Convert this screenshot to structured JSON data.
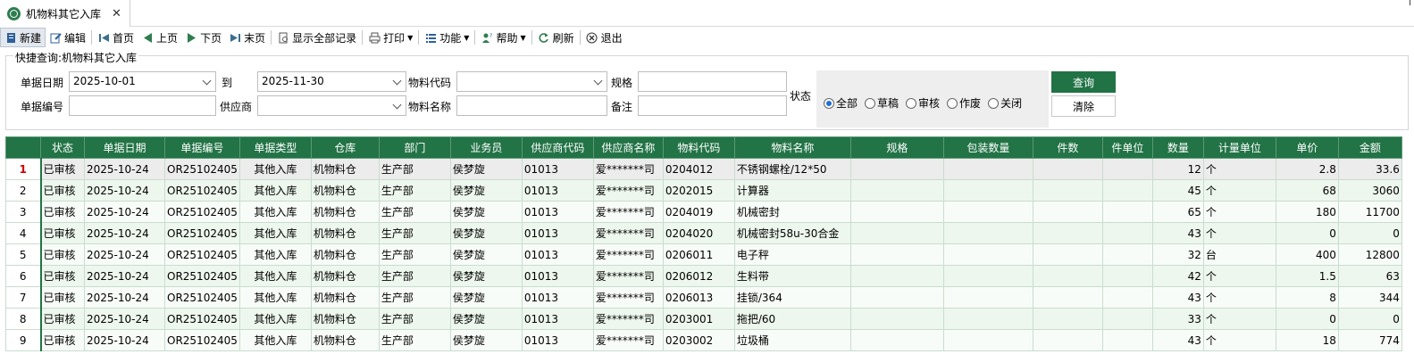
{
  "tab": {
    "title": "机物料其它入库",
    "close": "✕"
  },
  "toolbar": {
    "new": "新建",
    "edit": "编辑",
    "first": "首页",
    "prev": "上页",
    "next": "下页",
    "last": "末页",
    "show_all": "显示全部记录",
    "print": "打印",
    "func": "功能",
    "help": "帮助",
    "refresh": "刷新",
    "exit": "退出"
  },
  "quick": {
    "title": "快捷查询:机物料其它入库",
    "date_label": "单据日期",
    "date_from": "2025-10-01",
    "to_label": "到",
    "date_to": "2025-11-30",
    "material_code_label": "物料代码",
    "material_code": "",
    "spec_label": "规格",
    "spec": "",
    "status_label": "状态",
    "doc_no_label": "单据编号",
    "doc_no": "",
    "supplier_label": "供应商",
    "supplier": "",
    "material_name_label": "物料名称",
    "material_name": "",
    "remark_label": "备注",
    "remark": "",
    "status_options": [
      "全部",
      "草稿",
      "审核",
      "作废",
      "关闭"
    ],
    "status_selected": "全部",
    "query_button": "查询",
    "clear_button": "清除"
  },
  "grid": {
    "columns": [
      "状态",
      "单据日期",
      "单据编号",
      "单据类型",
      "仓库",
      "部门",
      "业务员",
      "供应商代码",
      "供应商名称",
      "物料代码",
      "物料名称",
      "规格",
      "包装数量",
      "件数",
      "件单位",
      "数量",
      "计量单位",
      "单价",
      "金额"
    ],
    "rows": [
      {
        "n": "1",
        "status": "已审核",
        "date": "2025-10-24",
        "no": "OR25102405",
        "type": "其他入库",
        "wh": "机物料仓",
        "dept": "生产部",
        "sales": "侯梦旋",
        "scode": "01013",
        "sname": "爱*******司",
        "mcode": "0204012",
        "mname": "不锈钢螺栓/12*50",
        "spec": "",
        "pack": "",
        "pcs": "",
        "pu": "",
        "qty": "12",
        "unit": "个",
        "price": "2.8",
        "amt": "33.6"
      },
      {
        "n": "2",
        "status": "已审核",
        "date": "2025-10-24",
        "no": "OR25102405",
        "type": "其他入库",
        "wh": "机物料仓",
        "dept": "生产部",
        "sales": "侯梦旋",
        "scode": "01013",
        "sname": "爱*******司",
        "mcode": "0202015",
        "mname": "计算器",
        "spec": "",
        "pack": "",
        "pcs": "",
        "pu": "",
        "qty": "45",
        "unit": "个",
        "price": "68",
        "amt": "3060"
      },
      {
        "n": "3",
        "status": "已审核",
        "date": "2025-10-24",
        "no": "OR25102405",
        "type": "其他入库",
        "wh": "机物料仓",
        "dept": "生产部",
        "sales": "侯梦旋",
        "scode": "01013",
        "sname": "爱*******司",
        "mcode": "0204019",
        "mname": "机械密封",
        "spec": "",
        "pack": "",
        "pcs": "",
        "pu": "",
        "qty": "65",
        "unit": "个",
        "price": "180",
        "amt": "11700"
      },
      {
        "n": "4",
        "status": "已审核",
        "date": "2025-10-24",
        "no": "OR25102405",
        "type": "其他入库",
        "wh": "机物料仓",
        "dept": "生产部",
        "sales": "侯梦旋",
        "scode": "01013",
        "sname": "爱*******司",
        "mcode": "0204020",
        "mname": "机械密封58u-30合金",
        "spec": "",
        "pack": "",
        "pcs": "",
        "pu": "",
        "qty": "43",
        "unit": "个",
        "price": "0",
        "amt": "0"
      },
      {
        "n": "5",
        "status": "已审核",
        "date": "2025-10-24",
        "no": "OR25102405",
        "type": "其他入库",
        "wh": "机物料仓",
        "dept": "生产部",
        "sales": "侯梦旋",
        "scode": "01013",
        "sname": "爱*******司",
        "mcode": "0206011",
        "mname": "电子秤",
        "spec": "",
        "pack": "",
        "pcs": "",
        "pu": "",
        "qty": "32",
        "unit": "台",
        "price": "400",
        "amt": "12800"
      },
      {
        "n": "6",
        "status": "已审核",
        "date": "2025-10-24",
        "no": "OR25102405",
        "type": "其他入库",
        "wh": "机物料仓",
        "dept": "生产部",
        "sales": "侯梦旋",
        "scode": "01013",
        "sname": "爱*******司",
        "mcode": "0206012",
        "mname": "生料带",
        "spec": "",
        "pack": "",
        "pcs": "",
        "pu": "",
        "qty": "42",
        "unit": "个",
        "price": "1.5",
        "amt": "63"
      },
      {
        "n": "7",
        "status": "已审核",
        "date": "2025-10-24",
        "no": "OR25102405",
        "type": "其他入库",
        "wh": "机物料仓",
        "dept": "生产部",
        "sales": "侯梦旋",
        "scode": "01013",
        "sname": "爱*******司",
        "mcode": "0206013",
        "mname": "挂锁/364",
        "spec": "",
        "pack": "",
        "pcs": "",
        "pu": "",
        "qty": "43",
        "unit": "个",
        "price": "8",
        "amt": "344"
      },
      {
        "n": "8",
        "status": "已审核",
        "date": "2025-10-24",
        "no": "OR25102405",
        "type": "其他入库",
        "wh": "机物料仓",
        "dept": "生产部",
        "sales": "侯梦旋",
        "scode": "01013",
        "sname": "爱*******司",
        "mcode": "0203001",
        "mname": "拖把/60",
        "spec": "",
        "pack": "",
        "pcs": "",
        "pu": "",
        "qty": "33",
        "unit": "个",
        "price": "0",
        "amt": "0"
      },
      {
        "n": "9",
        "status": "已审核",
        "date": "2025-10-24",
        "no": "OR25102405",
        "type": "其他入库",
        "wh": "机物料仓",
        "dept": "生产部",
        "sales": "侯梦旋",
        "scode": "01013",
        "sname": "爱*******司",
        "mcode": "0203002",
        "mname": "垃圾桶",
        "spec": "",
        "pack": "",
        "pcs": "",
        "pu": "",
        "qty": "43",
        "unit": "个",
        "price": "18",
        "amt": "774"
      }
    ]
  },
  "colors": {
    "header_green": "#227346",
    "row_green": "#edf7ed",
    "selected_row": "#ececec"
  }
}
